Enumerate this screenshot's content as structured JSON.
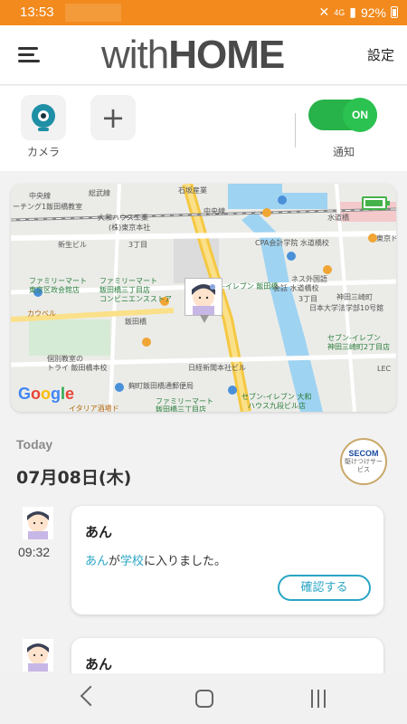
{
  "status_bar": {
    "time": "13:53",
    "battery": "92%",
    "signal_text": "4G"
  },
  "app": {
    "logo_light": "with",
    "logo_bold": "HOME",
    "settings_label": "設定"
  },
  "quick_actions": {
    "camera_label": "カメラ",
    "add_icon": "plus-icon",
    "notification_label": "通知",
    "toggle_state": "ON"
  },
  "map": {
    "labels": [
      "石坂産業",
      "中央線",
      "中央線",
      "総武線",
      "ーチング1飯田橋教室",
      "大和ハウス工業",
      "(株)東京本社",
      "3丁目",
      "新生ビル",
      "CPA会計学院 水道橋校",
      "東京ドーム",
      "水道橋",
      "ファミリーマート",
      "東京区政会館店",
      "ファミリーマート",
      "飯田橋三丁目店",
      "コンビニエンスストア",
      "セブン-イレブン 飯田橋",
      "ネス外国語",
      "会話 水道橋校",
      "3丁目",
      "神田三崎町",
      "日本大学法学部10号館",
      "カウベル",
      "飯田橋",
      "セブン-イレブン",
      "神田三崎町2丁目店",
      "個別教室の",
      "トライ 飯田橋本校",
      "日経新聞本社ビル",
      "ファミリーマート",
      "飯田橋三丁目店",
      "セブン-イレブン 大和",
      "ハウス九段ビル店",
      "LEC",
      "麹町飯田橋通郵便局",
      "イタリア酒場ド"
    ],
    "google_letters": [
      "G",
      "o",
      "o",
      "g",
      "l",
      "e"
    ]
  },
  "timeline": {
    "section_label": "Today",
    "date": "07月08日(木)",
    "secom": {
      "brand": "SECOM",
      "service": "駆けつけサービス"
    },
    "entries": [
      {
        "time": "09:32",
        "name": "あん",
        "msg_name": "あん",
        "msg_part1": "が",
        "msg_place": "学校",
        "msg_part2": "に入りました。",
        "button": "確認する"
      },
      {
        "time": "",
        "name": "あん"
      }
    ]
  },
  "colors": {
    "accent": "#2aa5c4",
    "status_bar": "#f28a1d",
    "toggle": "#2cc251"
  }
}
